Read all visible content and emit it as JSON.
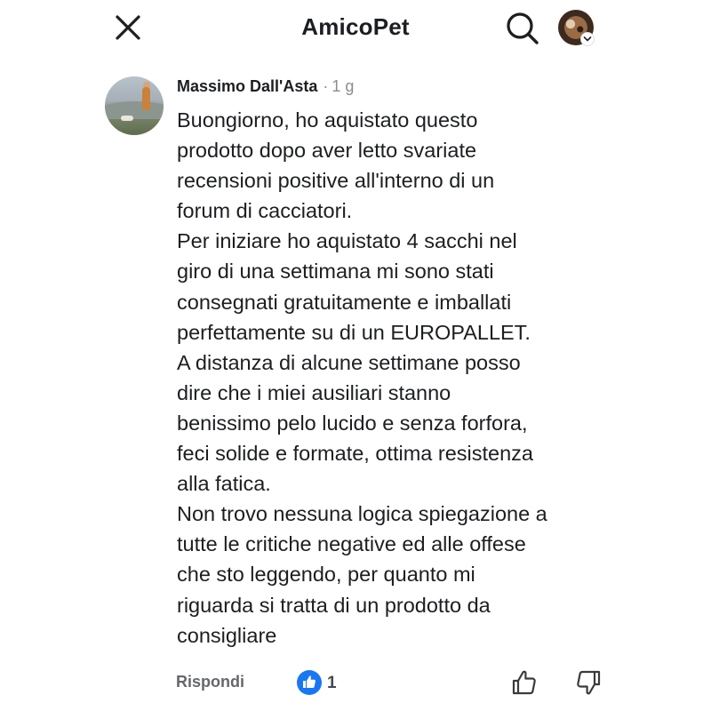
{
  "header": {
    "title": "AmicoPet",
    "close_icon": "close-icon",
    "search_icon": "search-icon",
    "profile_icon": "profile-avatar-icon"
  },
  "comment": {
    "author": "Massimo Dall'Asta",
    "separator": "·",
    "time": "1 g",
    "body_lines": [
      "Buongiorno, ho aquistato questo",
      "prodotto dopo aver letto svariate",
      "recensioni positive all'interno di un",
      "forum di cacciatori.",
      "Per iniziare ho aquistato 4 sacchi nel",
      "giro di una settimana mi sono stati",
      "consegnati gratuitamente e imballati",
      "perfettamente su di un EUROPALLET.",
      "A distanza di alcune settimane posso",
      "dire che i miei ausiliari stanno",
      "benissimo pelo lucido e senza forfora,",
      "feci solide e formate, ottima resistenza",
      "alla fatica.",
      "Non trovo nessuna logica spiegazione a",
      "tutte le critiche negative ed alle offese",
      "che sto leggendo, per quanto mi",
      "riguarda si tratta di un prodotto da",
      "consigliare"
    ]
  },
  "actions": {
    "reply_label": "Rispondi",
    "reaction_icon": "like-reaction-icon",
    "reaction_count": "1",
    "like_icon": "thumbs-up-icon",
    "dislike_icon": "thumbs-down-icon"
  },
  "colors": {
    "text": "#1c1e21",
    "secondary_text": "#65676b",
    "accent": "#1877f2"
  }
}
